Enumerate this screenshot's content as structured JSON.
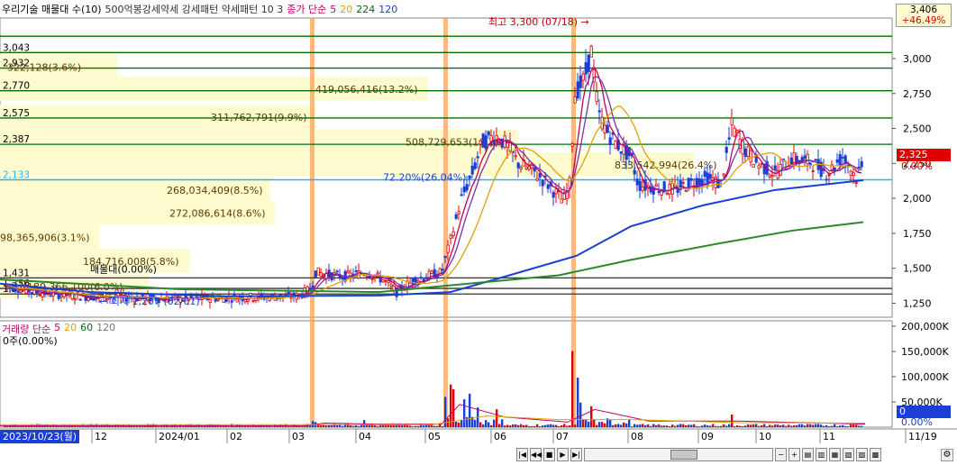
{
  "legend": {
    "title": "우리기술 매물대 수(10)",
    "indicator": "500억봉강세약세 강세패턴  약세패턴  10  3",
    "ma_label": "종가 단순",
    "ma": [
      "5",
      "20",
      "224",
      "120"
    ]
  },
  "volume_legend": {
    "title": "거래량 단순",
    "ma": [
      "5",
      "20",
      "60",
      "120"
    ],
    "value": "0주(0.00%)"
  },
  "current": {
    "price": "3,406",
    "change": "+46.49%",
    "last": "2,325",
    "last_pct": "0.00%",
    "vol_last": "0",
    "vol_pct": "0.00%"
  },
  "max_label": "최고 3,300 (07/18)",
  "min_label": "최저 1,207 (02/01)",
  "date_box": "2023/10/23(월)",
  "colors": {
    "up": "#e00000",
    "down": "#1a3fd6",
    "band": "#fffbd0",
    "level": "#007000",
    "highlight": "#f5a25a"
  },
  "chart_data": {
    "type": "candlestick",
    "x_ticks": [
      "12",
      "2024/01",
      "02",
      "03",
      "04",
      "05",
      "06",
      "07",
      "08",
      "09",
      "10",
      "11",
      "11/19"
    ],
    "y_ticks": [
      "3,000",
      "2,750",
      "2,500",
      "2,250",
      "2,000",
      "1,750",
      "1,500",
      "1,250"
    ],
    "ylim": [
      1150,
      3290
    ],
    "vol_ticks": [
      "200,000K",
      "150,000K",
      "100,000K",
      "50,000K"
    ],
    "vol_max": 200000,
    "level_labels": [
      "3,043",
      "2,932",
      "2,770",
      "2,575",
      "2,387",
      "2,133",
      "1,431",
      "1,356",
      "1,316"
    ],
    "level_values": [
      3043,
      2932,
      2770,
      2575,
      2387,
      2133,
      1431,
      1356,
      1316
    ],
    "profile": [
      {
        "label": "322,128(3.6%)",
        "price": 2940
      },
      {
        "label": "419,056,416(13.2%)",
        "price": 2780
      },
      {
        "label": "311,762,791(9.9%)",
        "price": 2580
      },
      {
        "label": "508,729,653(16.1%)",
        "price": 2405
      },
      {
        "label": "833,542,994(26.4%)",
        "price": 2240
      },
      {
        "label": "268,034,409(8.5%)",
        "price": 2060
      },
      {
        "label": "272,086,614(8.6%)",
        "price": 1895
      },
      {
        "label": "98,365,906(3.1%)",
        "price": 1720
      },
      {
        "label": "184,716,008(5.8%)",
        "price": 1550
      },
      {
        "label": "189,366,100(6.0%)",
        "price": 1370
      }
    ],
    "annotations": [
      "72.20%(26.04%)",
      "매물대(0.00%)"
    ]
  }
}
